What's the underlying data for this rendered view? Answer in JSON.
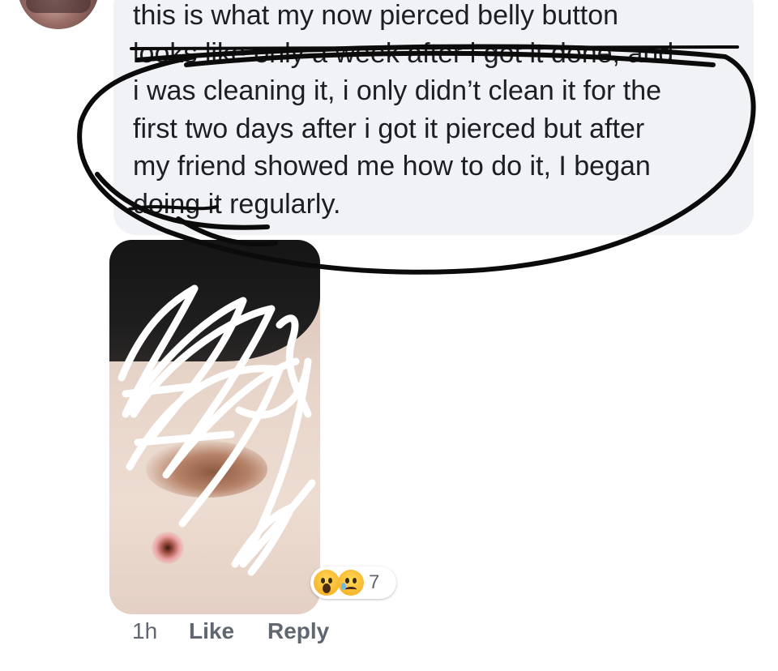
{
  "comment": {
    "lines": [
      "this is what my now pierced belly button",
      "looks like only a week after i got it done, and",
      "i was cleaning it, i only didn’t clean it for the",
      "first two days after i got it pierced but after",
      "my friend showed me how to do it, I began",
      "doing it regularly."
    ]
  },
  "reactions": {
    "icons": [
      "wow-icon",
      "sad-icon"
    ],
    "count": "7"
  },
  "actions": {
    "time": "1h",
    "like_label": "Like",
    "reply_label": "Reply"
  },
  "colors": {
    "bubble": "#f1f2f6",
    "text": "#1c1e21",
    "meta": "#606770",
    "annotation_ink": "#0b0b0b",
    "scribble": "#ffffff"
  }
}
